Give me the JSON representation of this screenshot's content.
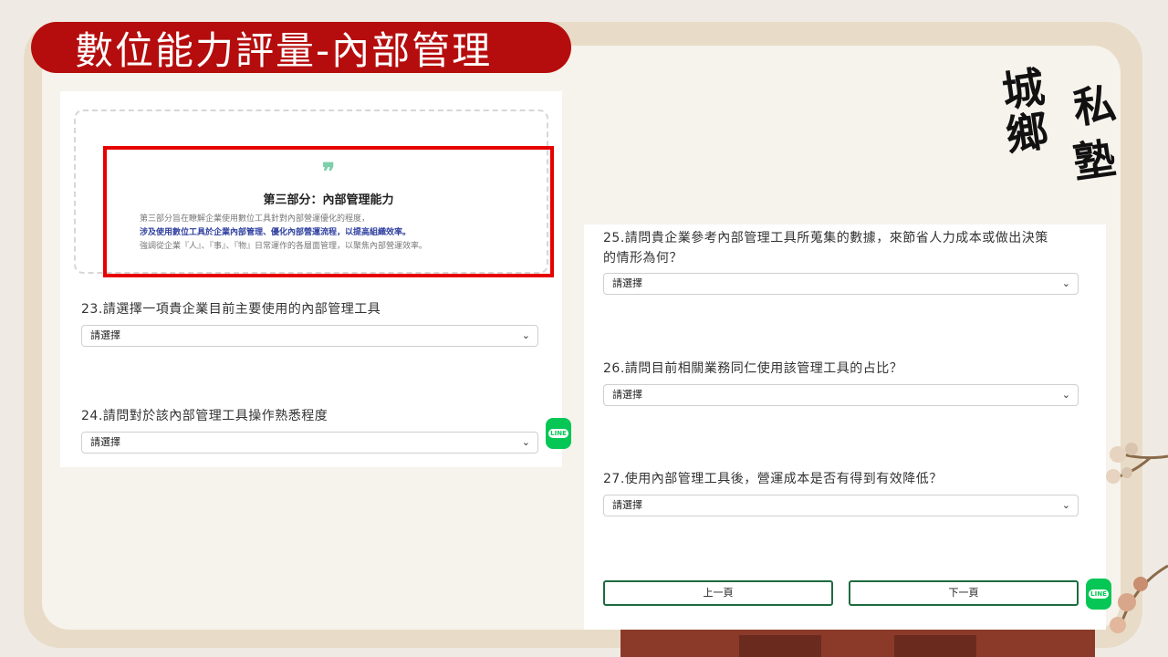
{
  "banner": {
    "title": "數位能力評量-內部管理"
  },
  "logo": {
    "chars": [
      "城",
      "鄉",
      "私",
      "塾"
    ]
  },
  "intro": {
    "quote_mark": "❞",
    "title": "第三部分：內部管理能力",
    "lines": [
      "第三部分旨在瞭解企業使用數位工具針對內部營運優化的程度，",
      "涉及使用數位工具於企業內部管理、優化內部營運流程，以提高組織效率。",
      "強調從企業『人』、『事』、『物』日常運作的各層面管理，以聚焦內部營運效率。"
    ]
  },
  "questions": {
    "q23": {
      "label": "23.請選擇一項貴企業目前主要使用的內部管理工具",
      "select": "請選擇"
    },
    "q24": {
      "label": "24.請問對於該內部管理工具操作熟悉程度",
      "select": "請選擇"
    },
    "q25": {
      "label_line1": "25.請問貴企業參考內部管理工具所蒐集的數據，來節省人力成本或做出決策",
      "label_line2": "的情形為何？",
      "select": "請選擇"
    },
    "q26": {
      "label": "26.請問目前相關業務同仁使用該管理工具的占比？",
      "select": "請選擇"
    },
    "q27": {
      "label": "27.使用內部管理工具後，營運成本是否有得到有效降低？",
      "select": "請選擇"
    }
  },
  "nav": {
    "prev": "上一頁",
    "next": "下一頁"
  },
  "line_badge": "LINE",
  "icons": {
    "chevron": "chevron-down-icon",
    "line": "line-chat-icon",
    "quote": "quote-icon"
  },
  "colors": {
    "banner": "#b50d0d",
    "highlight_frame": "#e60000",
    "button_border": "#1e6b40",
    "line_green": "#06c755"
  }
}
